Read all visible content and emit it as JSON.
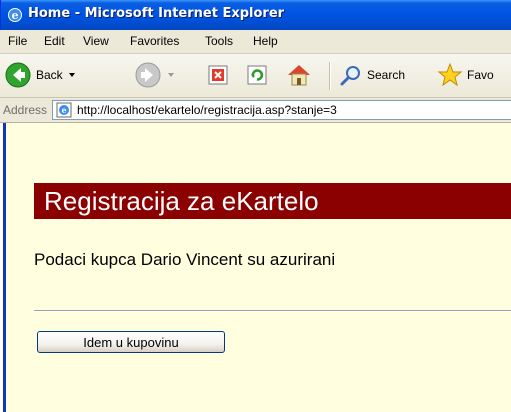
{
  "window": {
    "title": "Home - Microsoft Internet Explorer"
  },
  "menu": {
    "items": [
      "File",
      "Edit",
      "View",
      "Favorites",
      "Tools",
      "Help"
    ]
  },
  "toolbar": {
    "back_label": "Back",
    "search_label": "Search",
    "favorites_label": "Favo"
  },
  "address": {
    "label": "Address",
    "url": "http://localhost/ekartelo/registracija.asp?stanje=3"
  },
  "page": {
    "heading": "Registracija za eKartelo",
    "message": "Podaci kupca Dario Vincent su azurirani",
    "button_label": "Idem u kupovinu"
  },
  "colors": {
    "titlebar": "#0054e3",
    "heading_bg": "#8b0000",
    "content_bg": "#ffffe0"
  }
}
